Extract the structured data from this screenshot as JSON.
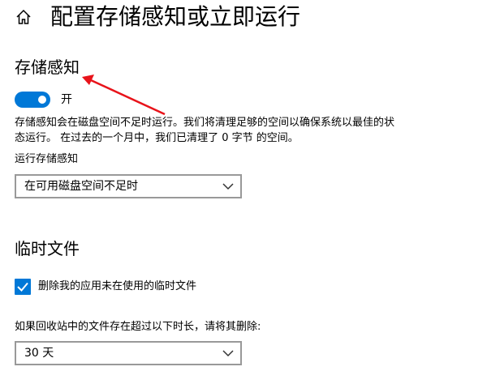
{
  "header": {
    "home_icon": "home-icon",
    "title": "配置存储感知或立即运行"
  },
  "storage_sense": {
    "title": "存储感知",
    "toggle_state": "on",
    "toggle_label": "开",
    "description": "存储感知会在磁盘空间不足时运行。我们将清理足够的空间以确保系统以最佳的状态运行。 在过去的一个月中，我们已清理了 0 字节 的空间。",
    "run_label": "运行存储感知",
    "run_value": "在可用磁盘空间不足时"
  },
  "temp_files": {
    "title": "临时文件",
    "delete_checkbox_checked": true,
    "delete_checkbox_label": "删除我的应用未在使用的临时文件",
    "recycle_label": "如果回收站中的文件存在超过以下时长，请将其删除:",
    "recycle_value": "30 天"
  },
  "annotation": {
    "icon": "red-arrow-annotation",
    "color": "#e8131a"
  },
  "colors": {
    "accent": "#0078d7",
    "dropdown_border": "#999999",
    "text": "#000000"
  }
}
